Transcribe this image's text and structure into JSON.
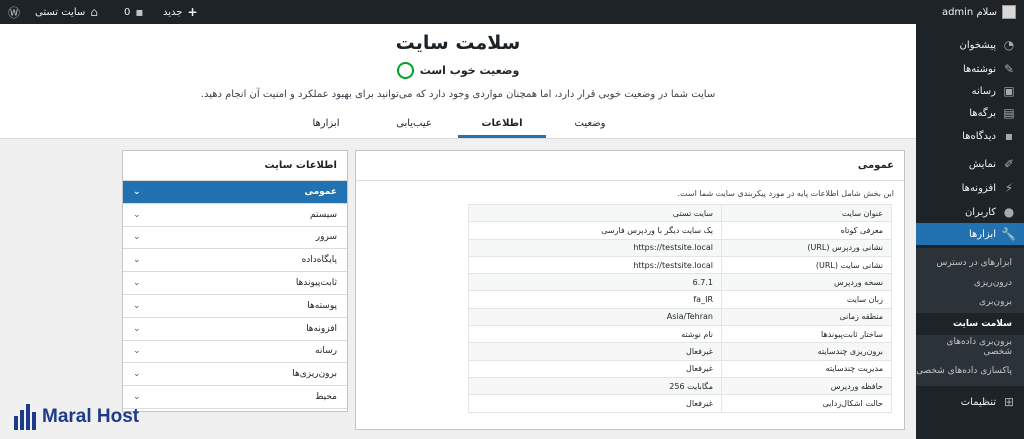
{
  "adminbar": {
    "user_greeting": "سلام admin",
    "site_name": "سایت تستی",
    "comments_count": "0",
    "new_label": "جدید"
  },
  "sidebar": {
    "items": [
      {
        "label": "پیشخوان",
        "icon": "dashboard-icon"
      },
      {
        "label": "نوشته‌ها",
        "icon": "pin-icon"
      },
      {
        "label": "رسانه",
        "icon": "media-icon"
      },
      {
        "label": "برگه‌ها",
        "icon": "pages-icon"
      },
      {
        "label": "دیدگاه‌ها",
        "icon": "comments-icon"
      },
      {
        "label": "نمایش",
        "icon": "appearance-icon"
      },
      {
        "label": "افزونه‌ها",
        "icon": "plugins-icon"
      },
      {
        "label": "کاربران",
        "icon": "users-icon"
      },
      {
        "label": "ابزارها",
        "icon": "tools-icon"
      },
      {
        "label": "تنظیمات",
        "icon": "settings-icon"
      }
    ],
    "submenu": [
      "ابزارهای در دسترس",
      "درون‌ریزی",
      "برون‌بری",
      "سلامت سایت",
      "برون‌بری داده‌های شخصی",
      "پاکسازی داده‌های شخصی"
    ]
  },
  "header": {
    "title": "سلامت سایت",
    "status": "وضعیت خوب است",
    "intro": "سایت شما در وضعیت خوبی قرار دارد، اما همچنان مواردی وجود دارد که می‌توانید برای بهبود عملکرد و امنیت آن انجام دهید.",
    "tabs": [
      "وضعیت",
      "اطلاعات",
      "عیب‌یابی",
      "ابزارها"
    ]
  },
  "nav": {
    "title": "اطلاعات سایت",
    "items": [
      "عمومی",
      "سیستم",
      "سرور",
      "پایگاه‌داده",
      "ثابت‌پیوندها",
      "پوسته‌ها",
      "افزونه‌ها",
      "رسانه",
      "برون‌ریزی‌ها",
      "محیط"
    ]
  },
  "main": {
    "heading": "عمومی",
    "description": "این بخش شامل اطلاعات پایه در مورد پیکربندی سایت شما است.",
    "rows": [
      {
        "key": "عنوان سایت",
        "value": "سایت تستی"
      },
      {
        "key": "معرفی کوتاه",
        "value": "یک سایت دیگر با وردپرس فارسی"
      },
      {
        "key": "نشانی وردپرس (URL)",
        "value": "https://testsite.local"
      },
      {
        "key": "نشانی سایت (URL)",
        "value": "https://testsite.local"
      },
      {
        "key": "نسخه وردپرس",
        "value": "6.7.1"
      },
      {
        "key": "زبان سایت",
        "value": "fa_IR"
      },
      {
        "key": "منطقه زمانی",
        "value": "Asia/Tehran"
      },
      {
        "key": "ساختار ثابت‌پیوندها",
        "value": "نام نوشته"
      },
      {
        "key": "برون‌ریزی چندسایته",
        "value": "غیرفعال"
      },
      {
        "key": "مدیریت چندسایته",
        "value": "غیرفعال"
      },
      {
        "key": "حافظه وردپرس",
        "value": "256 مگابایت"
      },
      {
        "key": "حالت اشکال‌زدایی",
        "value": "غیرفعال"
      }
    ]
  },
  "brand": {
    "name": "Maral Host"
  },
  "colors": {
    "accent": "#2271b1",
    "good": "#00a32a",
    "admin_bg": "#1d2327"
  }
}
